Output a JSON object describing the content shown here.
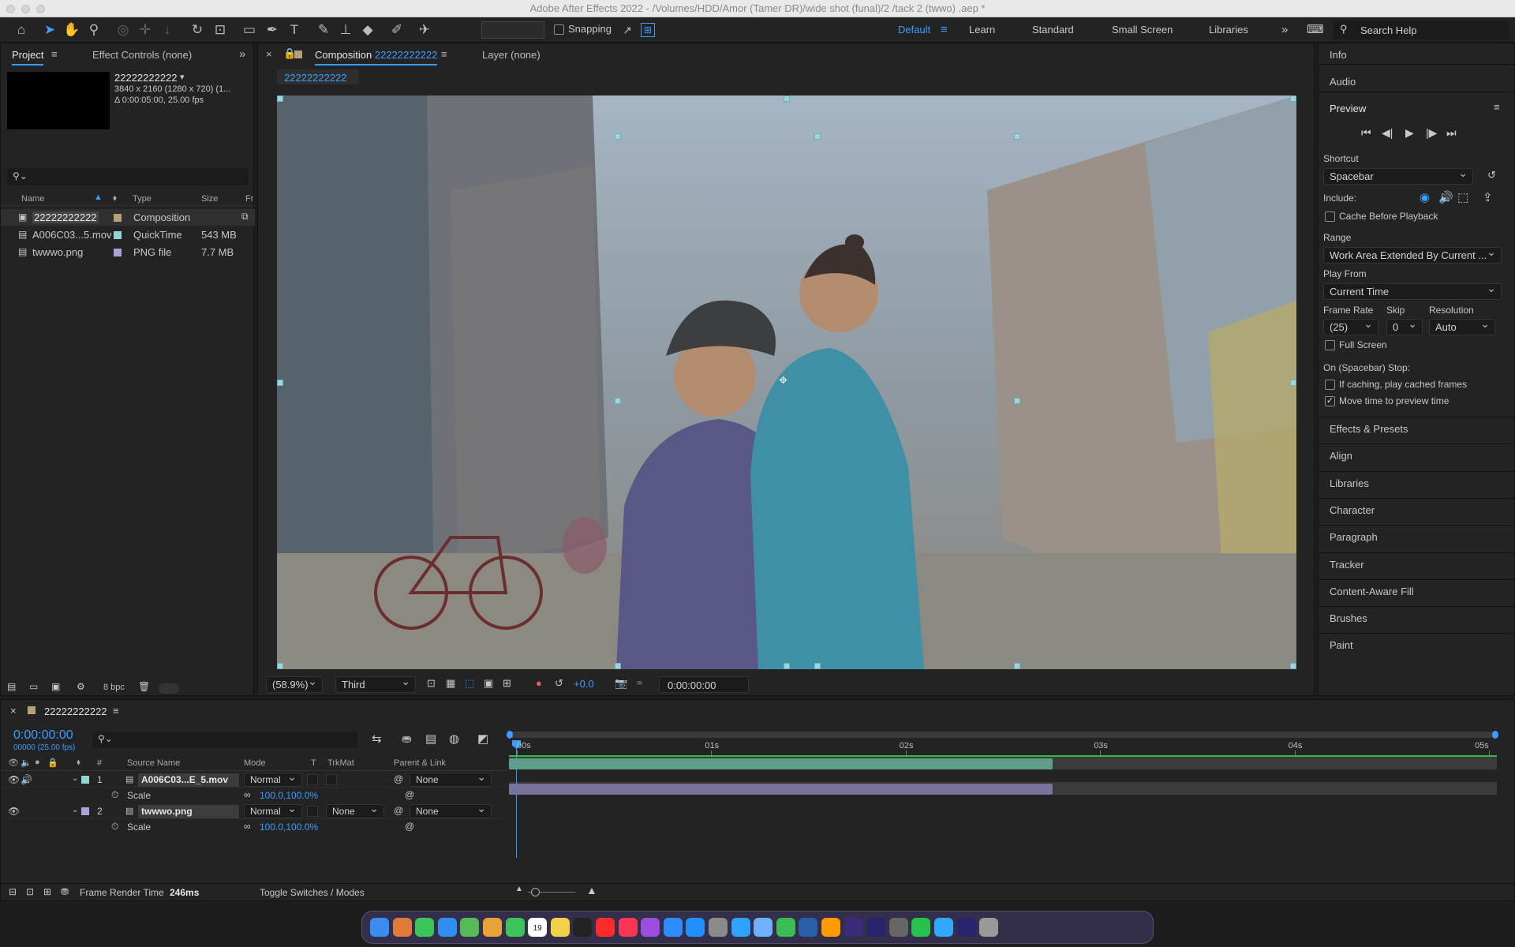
{
  "window": {
    "title": "Adobe After Effects 2022 - /Volumes/HDD/Amor (Tamer DR)/wide shot (funal)/2 /tack 2 (twwo) .aep *"
  },
  "toolbar": {
    "snapping_label": "Snapping",
    "workspaces": [
      "Default",
      "Learn",
      "Standard",
      "Small Screen",
      "Libraries"
    ],
    "search_placeholder": "Search Help"
  },
  "project_panel": {
    "tab_project": "Project",
    "tab_effect_controls": "Effect Controls (none)",
    "selected_name": "22222222222",
    "selected_info_1": "3840 x 2160  (1280 x 720) (1...",
    "selected_info_2": "Δ 0:00:05:00, 25.00 fps",
    "columns": {
      "name": "Name",
      "type": "Type",
      "size": "Size",
      "fr": "Fr"
    },
    "items": [
      {
        "name": "22222222222",
        "type": "Composition",
        "size": "",
        "label_color": "#b5a07a"
      },
      {
        "name": "A006C03...5.mov",
        "type": "QuickTime",
        "size": "543 MB",
        "label_color": "#8fd6d6"
      },
      {
        "name": "twwwo.png",
        "type": "PNG file",
        "size": "7.7 MB",
        "label_color": "#a8a3d8"
      }
    ],
    "bpc": "8 bpc"
  },
  "comp_panel": {
    "tab_label_prefix": "Composition",
    "tab_comp_name": "22222222222",
    "layer_tab": "Layer (none)",
    "breadcrumb": "22222222222",
    "zoom": "(58.9%)",
    "resolution": "Third",
    "exposure": "+0.0",
    "timecode": "0:00:00:00"
  },
  "right_panel": {
    "info": "Info",
    "audio": "Audio",
    "preview": "Preview",
    "shortcut_label": "Shortcut",
    "shortcut_value": "Spacebar",
    "include_label": "Include:",
    "cache_before": "Cache Before Playback",
    "range_label": "Range",
    "range_value": "Work Area Extended By Current ...",
    "play_from_label": "Play From",
    "play_from_value": "Current Time",
    "frame_rate_label": "Frame Rate",
    "skip_label": "Skip",
    "resolution_label": "Resolution",
    "frame_rate_value": "(25)",
    "skip_value": "0",
    "resolution_value": "Auto",
    "full_screen": "Full Screen",
    "on_stop": "On (Spacebar) Stop:",
    "if_caching": "If caching, play cached frames",
    "move_time": "Move time to preview time",
    "move_time_checked": true,
    "panels": [
      "Effects & Presets",
      "Align",
      "Libraries",
      "Character",
      "Paragraph",
      "Tracker",
      "Content-Aware Fill",
      "Brushes",
      "Paint"
    ]
  },
  "timeline": {
    "comp_name": "22222222222",
    "timecode": "0:00:00:00",
    "frame_info": "00000 (25.00 fps)",
    "columns": {
      "source_name": "Source Name",
      "mode": "Mode",
      "t": "T",
      "trkmat": "TrkMat",
      "parent": "Parent & Link"
    },
    "ruler": [
      "00s",
      "01s",
      "02s",
      "03s",
      "04s",
      "05s"
    ],
    "layers": [
      {
        "num": "1",
        "name": "A006C03...E_5.mov",
        "mode": "Normal",
        "trkmat": "",
        "parent": "None",
        "prop": "Scale",
        "value": "100.0,100.0%",
        "label_color": "#8fd6d6",
        "bar_color": "#5f9e8a",
        "bar_end": 0.55
      },
      {
        "num": "2",
        "name": "twwwo.png",
        "mode": "Normal",
        "trkmat": "None",
        "parent": "None",
        "prop": "Scale",
        "value": "100.0,100.0%",
        "label_color": "#a8a3d8",
        "bar_color": "#77739c",
        "bar_end": 0.55
      }
    ],
    "render_time_label": "Frame Render Time",
    "render_time_value": "246ms",
    "toggle_label": "Toggle Switches / Modes"
  },
  "dock": {
    "calendar_day": "19",
    "apps": [
      "finder",
      "launchpad",
      "messages",
      "mail",
      "maps",
      "photos",
      "facetime",
      "calendar",
      "notes",
      "tv",
      "youtube",
      "music",
      "podcasts",
      "zoom",
      "app-store",
      "settings",
      "safari",
      "preview",
      "chrome",
      "lightroom",
      "illustrator",
      "media-encoder",
      "after-effects",
      "obs",
      "whatsapp",
      "photoshop",
      "after-effects-2",
      "trash"
    ]
  }
}
